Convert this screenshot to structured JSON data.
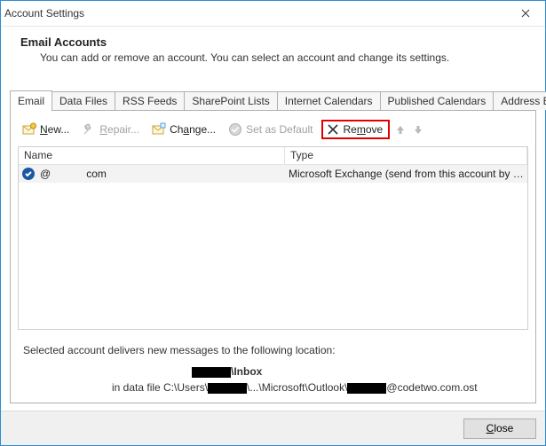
{
  "window": {
    "title": "Account Settings",
    "close_label": "Close"
  },
  "header": {
    "title": "Email Accounts",
    "description": "You can add or remove an account. You can select an account and change its settings."
  },
  "tabs": [
    {
      "label": "Email",
      "active": true
    },
    {
      "label": "Data Files"
    },
    {
      "label": "RSS Feeds"
    },
    {
      "label": "SharePoint Lists"
    },
    {
      "label": "Internet Calendars"
    },
    {
      "label": "Published Calendars"
    },
    {
      "label": "Address Books"
    }
  ],
  "toolbar": {
    "new_label": "New...",
    "repair_label": "Repair...",
    "change_label": "Change...",
    "set_default_label": "Set as Default",
    "remove_label": "Remove"
  },
  "table": {
    "columns": {
      "name": "Name",
      "type": "Type"
    },
    "rows": [
      {
        "name_part1": "@",
        "name_part2": "com",
        "type": "Microsoft Exchange (send from this account by def..."
      }
    ]
  },
  "info": {
    "line1": "Selected account delivers new messages to the following location:",
    "location_label": "\\Inbox",
    "path_prefix": "in data file C:\\Users\\",
    "path_mid": "\\...\\Microsoft\\Outlook\\",
    "path_suffix": "@codetwo.com.ost"
  },
  "footer": {
    "close_label": "Close"
  }
}
